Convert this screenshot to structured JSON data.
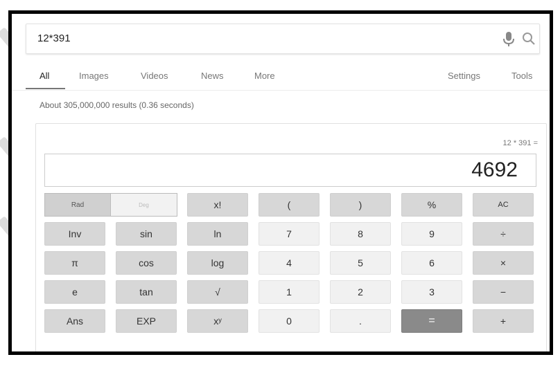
{
  "search": {
    "query": "12*391"
  },
  "tabs": [
    {
      "label": "All"
    },
    {
      "label": "Images"
    },
    {
      "label": "Videos"
    },
    {
      "label": "News"
    },
    {
      "label": "More"
    },
    {
      "label": "Settings"
    },
    {
      "label": "Tools"
    }
  ],
  "results": {
    "stats": "About 305,000,000 results (0.36 seconds)"
  },
  "calculator": {
    "expression": "12 * 391 =",
    "result": "4692",
    "angle_mode": {
      "rad": "Rad",
      "deg": "Deg"
    },
    "rows": [
      [
        "x!",
        "(",
        ")",
        "%",
        "AC"
      ],
      [
        "Inv",
        "sin",
        "ln",
        "7",
        "8",
        "9",
        "÷"
      ],
      [
        "π",
        "cos",
        "log",
        "4",
        "5",
        "6",
        "×"
      ],
      [
        "e",
        "tan",
        "√",
        "1",
        "2",
        "3",
        "−"
      ],
      [
        "Ans",
        "EXP",
        "xʸ",
        "0",
        ".",
        "=",
        "+"
      ]
    ]
  },
  "icons": [
    "mic-icon",
    "search-icon"
  ],
  "colors": {
    "function_key": "#d7d7d7",
    "digit_key": "#f1f1f1",
    "equals_key": "#8a8a8a",
    "frame": "#000000"
  }
}
